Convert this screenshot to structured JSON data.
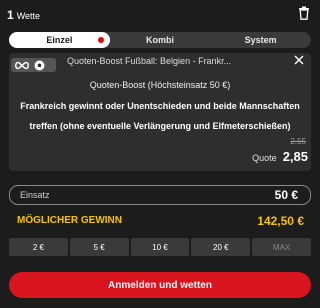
{
  "header": {
    "count": "1",
    "count_label": "Wette"
  },
  "tabs": [
    {
      "label": "Einzel"
    },
    {
      "label": "Kombi"
    },
    {
      "label": "System"
    }
  ],
  "bet": {
    "title": "Quoten-Boost Fußball: Belgien - Frankr...",
    "boost_label": "Quoten-Boost (Höchsteinsatz 50 €)",
    "selection": "Frankreich gewinnt oder Unentschieden und beide Mannschaften treffen (ohne eventuelle Verlängerung und Elfmeterschießen)",
    "old_quote": "2,55",
    "quote_label": "Quote",
    "quote_value": "2,85"
  },
  "stake": {
    "label": "Einsatz",
    "value": "50 €"
  },
  "win": {
    "label": "MÖGLICHER GEWINN",
    "value": "142,50 €"
  },
  "quick_stakes": [
    "2 €",
    "5 €",
    "10 €",
    "20 €",
    "MAX"
  ],
  "submit": {
    "label": "Anmelden und wetten"
  },
  "colors": {
    "accent_red": "#d8141e",
    "win_yellow": "#f5c400",
    "background": "#1c1c1c"
  }
}
